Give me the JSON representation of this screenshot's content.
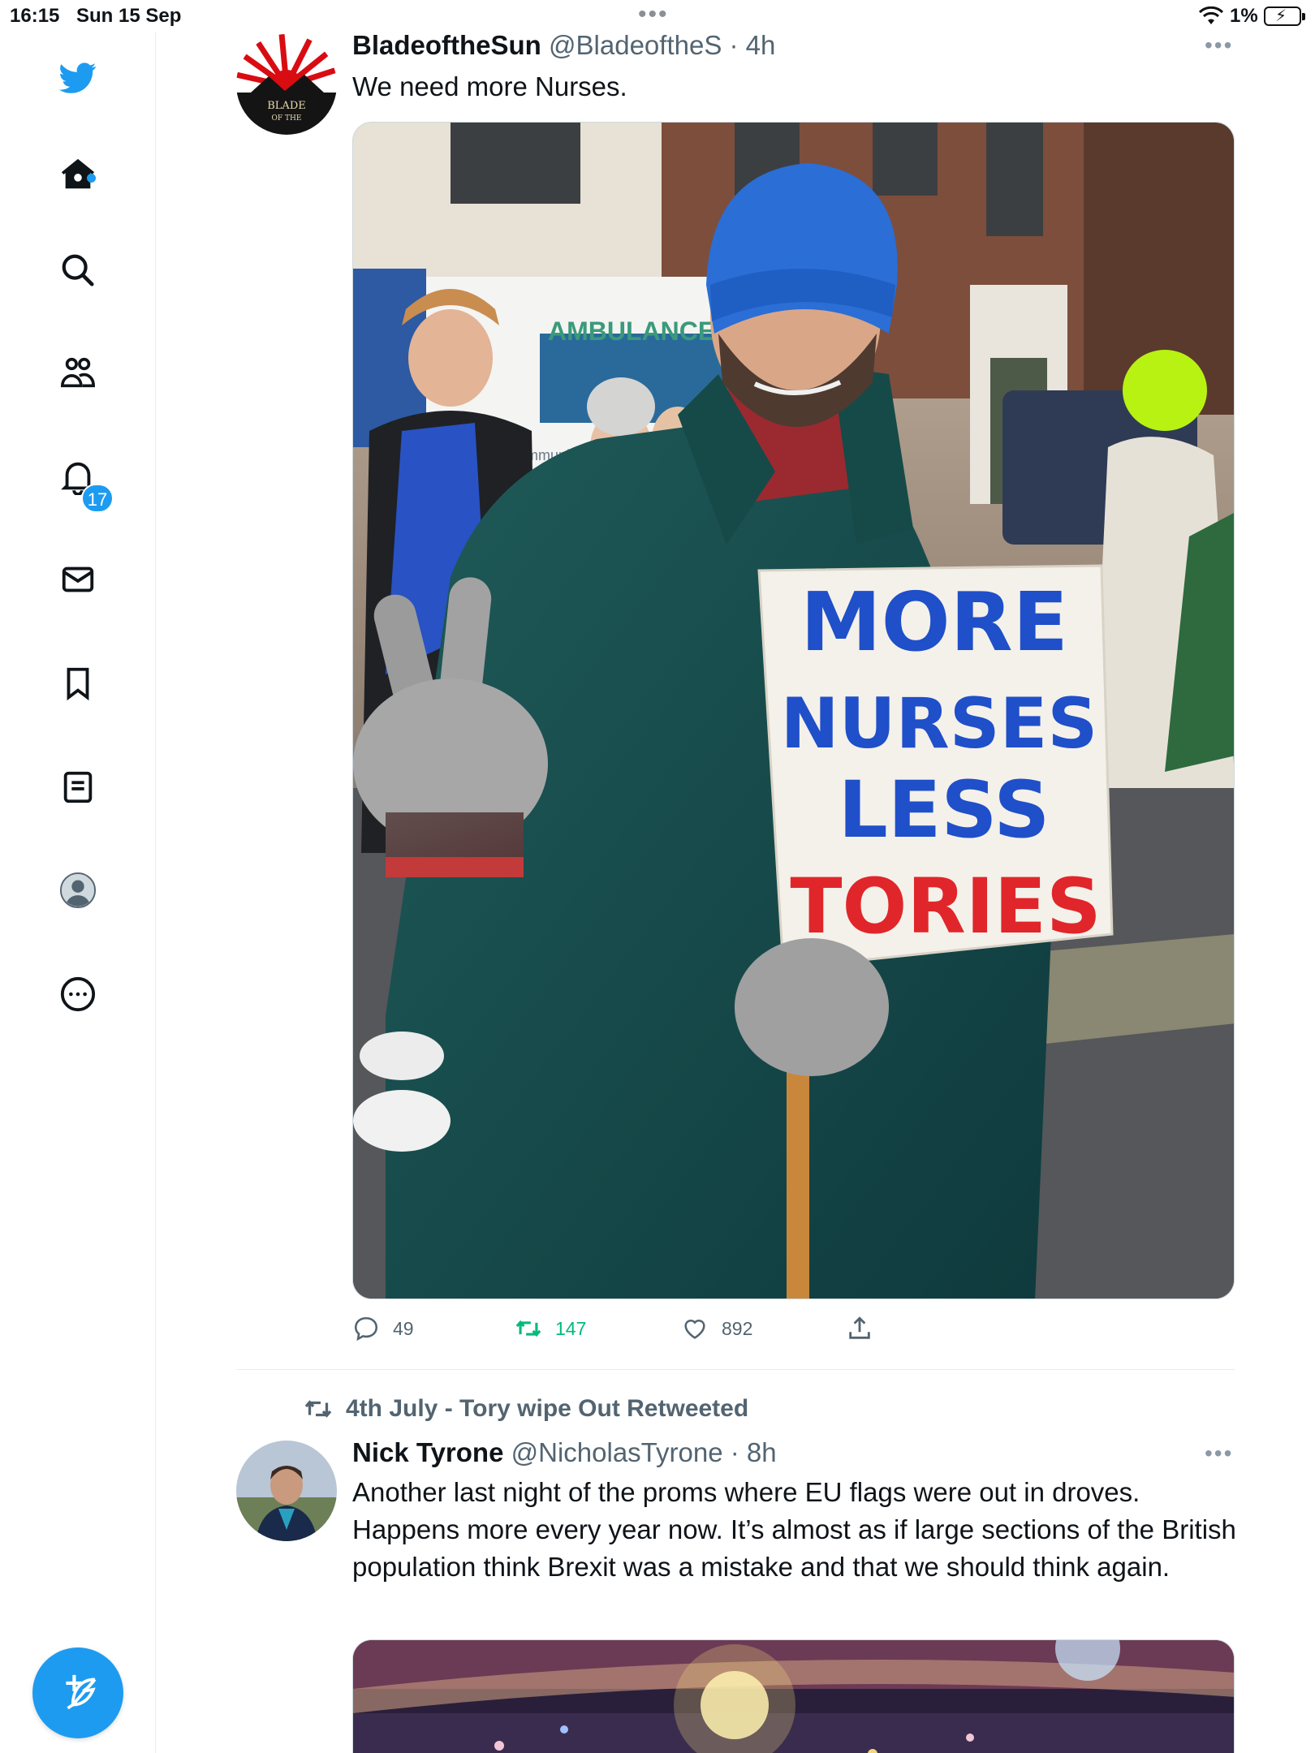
{
  "status": {
    "time": "16:15",
    "date": "Sun 15 Sep",
    "battery": "1%"
  },
  "nav": {
    "notifications_count": "17"
  },
  "tweets": [
    {
      "name": "BladeoftheSun",
      "handle": "@BladeoftheS",
      "time": "· 4h",
      "text": "We need more Nurses.",
      "avatar_text": [
        "BLADE",
        "OF THE"
      ],
      "image": {
        "ambulance_text": "AMBULANCE",
        "community_text": "Community",
        "sign_lines": [
          "MORE",
          "NURSES",
          "LESS",
          "TORIES"
        ]
      },
      "replies": "49",
      "retweets": "147",
      "likes": "892"
    },
    {
      "retweeted_by": "4th July - Tory wipe Out Retweeted",
      "name": "Nick Tyrone",
      "handle": "@NicholasTyrone",
      "time": "· 8h",
      "text": "Another last night of the proms where EU flags were out in droves. Happens more every year now. It’s almost as if large sections of the British population think Brexit was a mistake and that we should think again."
    }
  ],
  "colors": {
    "accent": "#1d9bf0",
    "retweet": "#00ba7c",
    "sign_blue": "#1f4fc9",
    "sign_red": "#e0262a"
  }
}
